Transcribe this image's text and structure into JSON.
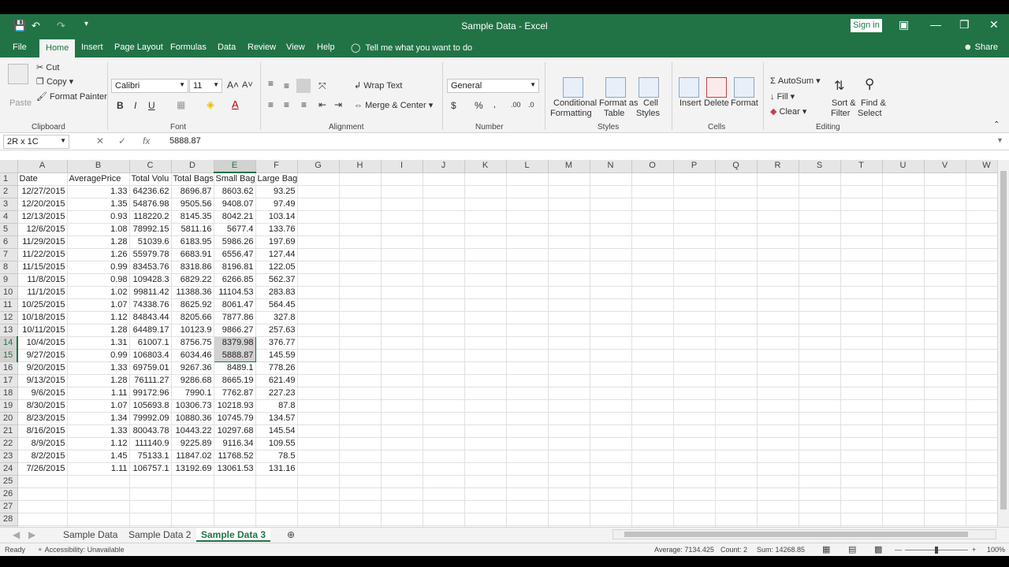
{
  "window": {
    "title": "Sample Data  -  Excel",
    "signin_label": "Sign in",
    "share_label": "Share"
  },
  "tabs": [
    "File",
    "Home",
    "Insert",
    "Page Layout",
    "Formulas",
    "Data",
    "Review",
    "View",
    "Help"
  ],
  "tellme": "Tell me what you want to do",
  "ribbon": {
    "clipboard": {
      "paste": "Paste",
      "cut": "Cut",
      "copy": "Copy",
      "format_painter": "Format Painter",
      "label": "Clipboard"
    },
    "font": {
      "name": "Calibri",
      "size": "11",
      "label": "Font"
    },
    "alignment": {
      "wrap": "Wrap Text",
      "merge": "Merge & Center",
      "label": "Alignment"
    },
    "number": {
      "format": "General",
      "label": "Number"
    },
    "styles": {
      "cond1": "Conditional",
      "cond2": "Formatting",
      "fmt1": "Format as",
      "fmt2": "Table",
      "cell1": "Cell",
      "cell2": "Styles",
      "label": "Styles"
    },
    "cells": {
      "insert": "Insert",
      "delete": "Delete",
      "format": "Format",
      "label": "Cells"
    },
    "editing": {
      "autosum": "AutoSum",
      "fill": "Fill",
      "clear": "Clear",
      "sort1": "Sort &",
      "sort2": "Filter",
      "find1": "Find &",
      "find2": "Select",
      "label": "Editing"
    }
  },
  "formula_bar": {
    "name_box": "2R x 1C",
    "value": "5888.87"
  },
  "columns": [
    "A",
    "B",
    "C",
    "D",
    "E",
    "F",
    "G",
    "H",
    "I",
    "J",
    "K",
    "L",
    "M",
    "N",
    "O",
    "P",
    "Q",
    "R",
    "S",
    "T",
    "U",
    "V",
    "W"
  ],
  "headers": [
    "Date",
    "AveragePrice",
    "Total Volu",
    "Total Bags",
    "Small Bags",
    "Large Bags"
  ],
  "rows": [
    [
      "12/27/2015",
      "1.33",
      "64236.62",
      "8696.87",
      "8603.62",
      "93.25"
    ],
    [
      "12/20/2015",
      "1.35",
      "54876.98",
      "9505.56",
      "9408.07",
      "97.49"
    ],
    [
      "12/13/2015",
      "0.93",
      "118220.2",
      "8145.35",
      "8042.21",
      "103.14"
    ],
    [
      "12/6/2015",
      "1.08",
      "78992.15",
      "5811.16",
      "5677.4",
      "133.76"
    ],
    [
      "11/29/2015",
      "1.28",
      "51039.6",
      "6183.95",
      "5986.26",
      "197.69"
    ],
    [
      "11/22/2015",
      "1.26",
      "55979.78",
      "6683.91",
      "6556.47",
      "127.44"
    ],
    [
      "11/15/2015",
      "0.99",
      "83453.76",
      "8318.86",
      "8196.81",
      "122.05"
    ],
    [
      "11/8/2015",
      "0.98",
      "109428.3",
      "6829.22",
      "6266.85",
      "562.37"
    ],
    [
      "11/1/2015",
      "1.02",
      "99811.42",
      "11388.36",
      "11104.53",
      "283.83"
    ],
    [
      "10/25/2015",
      "1.07",
      "74338.76",
      "8625.92",
      "8061.47",
      "564.45"
    ],
    [
      "10/18/2015",
      "1.12",
      "84843.44",
      "8205.66",
      "7877.86",
      "327.8"
    ],
    [
      "10/11/2015",
      "1.28",
      "64489.17",
      "10123.9",
      "9866.27",
      "257.63"
    ],
    [
      "10/4/2015",
      "1.31",
      "61007.1",
      "8756.75",
      "8379.98",
      "376.77"
    ],
    [
      "9/27/2015",
      "0.99",
      "106803.4",
      "6034.46",
      "5888.87",
      "145.59"
    ],
    [
      "9/20/2015",
      "1.33",
      "69759.01",
      "9267.36",
      "8489.1",
      "778.26"
    ],
    [
      "9/13/2015",
      "1.28",
      "76111.27",
      "9286.68",
      "8665.19",
      "621.49"
    ],
    [
      "9/6/2015",
      "1.11",
      "99172.96",
      "7990.1",
      "7762.87",
      "227.23"
    ],
    [
      "8/30/2015",
      "1.07",
      "105693.8",
      "10306.73",
      "10218.93",
      "87.8"
    ],
    [
      "8/23/2015",
      "1.34",
      "79992.09",
      "10880.36",
      "10745.79",
      "134.57"
    ],
    [
      "8/16/2015",
      "1.33",
      "80043.78",
      "10443.22",
      "10297.68",
      "145.54"
    ],
    [
      "8/9/2015",
      "1.12",
      "111140.9",
      "9225.89",
      "9116.34",
      "109.55"
    ],
    [
      "8/2/2015",
      "1.45",
      "75133.1",
      "11847.02",
      "11768.52",
      "78.5"
    ],
    [
      "7/26/2015",
      "1.11",
      "106757.1",
      "13192.69",
      "13061.53",
      "131.16"
    ]
  ],
  "sheets": [
    "Sample Data",
    "Sample Data 2",
    "Sample Data 3"
  ],
  "active_sheet": "Sample Data 3",
  "status": {
    "ready": "Ready",
    "accessibility": "Accessibility: Unavailable",
    "average": "Average: 7134.425",
    "count": "Count: 2",
    "sum": "Sum: 14268.85",
    "zoom": "100%"
  },
  "colors": {
    "accent": "#217346"
  }
}
